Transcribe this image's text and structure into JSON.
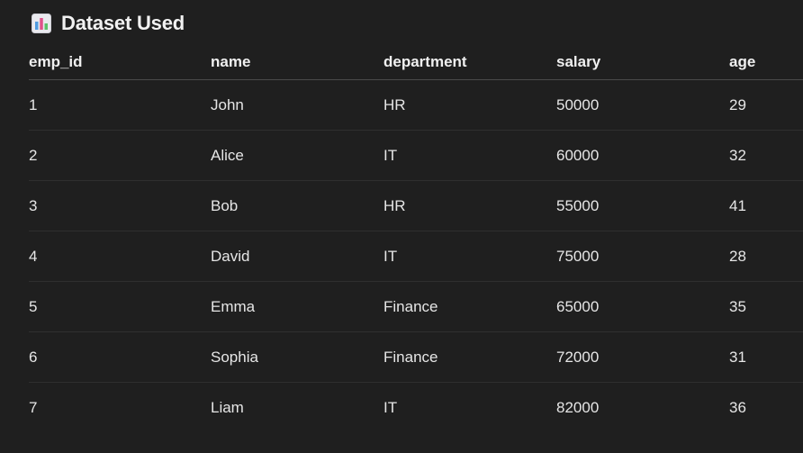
{
  "section": {
    "title": "Dataset Used",
    "icon": "bar-chart-icon"
  },
  "table": {
    "columns": [
      "emp_id",
      "name",
      "department",
      "salary",
      "age"
    ],
    "rows": [
      [
        "1",
        "John",
        "HR",
        "50000",
        "29"
      ],
      [
        "2",
        "Alice",
        "IT",
        "60000",
        "32"
      ],
      [
        "3",
        "Bob",
        "HR",
        "55000",
        "41"
      ],
      [
        "4",
        "David",
        "IT",
        "75000",
        "28"
      ],
      [
        "5",
        "Emma",
        "Finance",
        "65000",
        "35"
      ],
      [
        "6",
        "Sophia",
        "Finance",
        "72000",
        "31"
      ],
      [
        "7",
        "Liam",
        "IT",
        "82000",
        "36"
      ]
    ]
  },
  "colors": {
    "background": "#1f1f1f",
    "text": "#e6e6e6"
  }
}
